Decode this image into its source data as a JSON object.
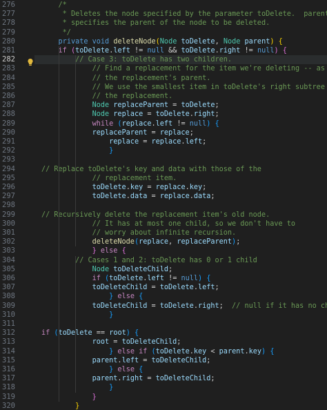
{
  "editor": {
    "language": "java",
    "active_line": 282,
    "gutter_icon": "lightbulb-icon",
    "colors": {
      "background": "#1f1f1f",
      "comment": "#6a9955",
      "keyword": "#569cd6",
      "control_keyword": "#c586c0",
      "type": "#4ec9b0",
      "function": "#dcdcaa",
      "variable": "#9cdcfe",
      "bracket_level_1": "#ffd700",
      "bracket_level_2": "#da70d6",
      "bracket_level_3": "#179fff"
    },
    "lines": [
      {
        "n": "276",
        "tokens": [
          [
            "cm",
            "/*"
          ]
        ]
      },
      {
        "n": "277",
        "tokens": [
          [
            "cm",
            "* Deletes the node specified by the parameter toDelete.  parent"
          ]
        ]
      },
      {
        "n": "278",
        "tokens": [
          [
            "cm",
            "* specifies the parent of the node to be deleted."
          ]
        ]
      },
      {
        "n": "279",
        "tokens": [
          [
            "cm",
            "*/"
          ]
        ]
      },
      {
        "n": "280",
        "tokens": [
          [
            "kw",
            "private"
          ],
          [
            "pl",
            " "
          ],
          [
            "kw",
            "void"
          ],
          [
            "pl",
            " "
          ],
          [
            "fn",
            "deleteNode"
          ],
          [
            "b1",
            "("
          ],
          [
            "ty",
            "Node"
          ],
          [
            "pl",
            " "
          ],
          [
            "var",
            "toDelete"
          ],
          [
            "pl",
            ", "
          ],
          [
            "ty",
            "Node"
          ],
          [
            "pl",
            " "
          ],
          [
            "var",
            "parent"
          ],
          [
            "b1",
            ")"
          ],
          [
            "pl",
            " "
          ],
          [
            "b1",
            "{"
          ]
        ]
      },
      {
        "n": "281",
        "tokens": [
          [
            "ctl",
            "if"
          ],
          [
            "pl",
            " "
          ],
          [
            "b2",
            "("
          ],
          [
            "var",
            "toDelete"
          ],
          [
            "pl",
            "."
          ],
          [
            "var",
            "left"
          ],
          [
            "pl",
            " != "
          ],
          [
            "kw",
            "null"
          ],
          [
            "pl",
            " && "
          ],
          [
            "var",
            "toDelete"
          ],
          [
            "pl",
            "."
          ],
          [
            "var",
            "right"
          ],
          [
            "pl",
            " != "
          ],
          [
            "kw",
            "null"
          ],
          [
            "b2",
            ")"
          ],
          [
            "pl",
            " "
          ],
          [
            "b2",
            "{"
          ]
        ]
      },
      {
        "n": "282",
        "tokens": [
          [
            "cm",
            "// Case 3: toDelete has two children."
          ]
        ]
      },
      {
        "n": "283",
        "tokens": [
          [
            "cm",
            "// Find a replacement for the item we're deleting -- as well as"
          ]
        ]
      },
      {
        "n": "284",
        "tokens": [
          [
            "cm",
            "// the replacement's parent."
          ]
        ]
      },
      {
        "n": "285",
        "tokens": [
          [
            "cm",
            "// We use the smallest item in toDelete's right subtree as"
          ]
        ]
      },
      {
        "n": "286",
        "tokens": [
          [
            "cm",
            "// the replacement."
          ]
        ]
      },
      {
        "n": "287",
        "tokens": [
          [
            "ty",
            "Node"
          ],
          [
            "pl",
            " "
          ],
          [
            "var",
            "replaceParent"
          ],
          [
            "pl",
            " = "
          ],
          [
            "var",
            "toDelete"
          ],
          [
            "pl",
            ";"
          ]
        ]
      },
      {
        "n": "288",
        "tokens": [
          [
            "ty",
            "Node"
          ],
          [
            "pl",
            " "
          ],
          [
            "var",
            "replace"
          ],
          [
            "pl",
            " = "
          ],
          [
            "var",
            "toDelete"
          ],
          [
            "pl",
            "."
          ],
          [
            "var",
            "right"
          ],
          [
            "pl",
            ";"
          ]
        ]
      },
      {
        "n": "289",
        "tokens": [
          [
            "ctl",
            "while"
          ],
          [
            "pl",
            " "
          ],
          [
            "b3",
            "("
          ],
          [
            "var",
            "replace"
          ],
          [
            "pl",
            "."
          ],
          [
            "var",
            "left"
          ],
          [
            "pl",
            " != "
          ],
          [
            "kw",
            "null"
          ],
          [
            "b3",
            ")"
          ],
          [
            "pl",
            " "
          ],
          [
            "b3",
            "{"
          ]
        ]
      },
      {
        "n": "290",
        "tokens": [
          [
            "var",
            "replaceParent"
          ],
          [
            "pl",
            " = "
          ],
          [
            "var",
            "replace"
          ],
          [
            "pl",
            ";"
          ]
        ]
      },
      {
        "n": "291",
        "tokens": [
          [
            "var",
            "replace"
          ],
          [
            "pl",
            " = "
          ],
          [
            "var",
            "replace"
          ],
          [
            "pl",
            "."
          ],
          [
            "var",
            "left"
          ],
          [
            "pl",
            ";"
          ]
        ]
      },
      {
        "n": "292",
        "tokens": [
          [
            "b3",
            "}"
          ]
        ]
      },
      {
        "n": "293",
        "tokens": []
      },
      {
        "n": "294",
        "tokens": [
          [
            "cm",
            "// Replace toDelete's key and data with those of the"
          ]
        ]
      },
      {
        "n": "295",
        "tokens": [
          [
            "cm",
            "// replacement item."
          ]
        ]
      },
      {
        "n": "296",
        "tokens": [
          [
            "var",
            "toDelete"
          ],
          [
            "pl",
            "."
          ],
          [
            "var",
            "key"
          ],
          [
            "pl",
            " = "
          ],
          [
            "var",
            "replace"
          ],
          [
            "pl",
            "."
          ],
          [
            "var",
            "key"
          ],
          [
            "pl",
            ";"
          ]
        ]
      },
      {
        "n": "297",
        "tokens": [
          [
            "var",
            "toDelete"
          ],
          [
            "pl",
            "."
          ],
          [
            "var",
            "data"
          ],
          [
            "pl",
            " = "
          ],
          [
            "var",
            "replace"
          ],
          [
            "pl",
            "."
          ],
          [
            "var",
            "data"
          ],
          [
            "pl",
            ";"
          ]
        ]
      },
      {
        "n": "298",
        "tokens": []
      },
      {
        "n": "299",
        "tokens": [
          [
            "cm",
            "// Recursively delete the replacement item's old node."
          ]
        ]
      },
      {
        "n": "300",
        "tokens": [
          [
            "cm",
            "// It has at most one child, so we don't have to"
          ]
        ]
      },
      {
        "n": "301",
        "tokens": [
          [
            "cm",
            "// worry about infinite recursion."
          ]
        ]
      },
      {
        "n": "302",
        "tokens": [
          [
            "fn",
            "deleteNode"
          ],
          [
            "b3",
            "("
          ],
          [
            "var",
            "replace"
          ],
          [
            "pl",
            ", "
          ],
          [
            "var",
            "replaceParent"
          ],
          [
            "b3",
            ")"
          ],
          [
            "pl",
            ";"
          ]
        ]
      },
      {
        "n": "303",
        "tokens": [
          [
            "b2",
            "}"
          ],
          [
            "pl",
            " "
          ],
          [
            "ctl",
            "else"
          ],
          [
            "pl",
            " "
          ],
          [
            "b2",
            "{"
          ]
        ]
      },
      {
        "n": "304",
        "tokens": [
          [
            "cm",
            "// Cases 1 and 2: toDelete has 0 or 1 child"
          ]
        ]
      },
      {
        "n": "305",
        "tokens": [
          [
            "ty",
            "Node"
          ],
          [
            "pl",
            " "
          ],
          [
            "var",
            "toDeleteChild"
          ],
          [
            "pl",
            ";"
          ]
        ]
      },
      {
        "n": "306",
        "tokens": [
          [
            "ctl",
            "if"
          ],
          [
            "pl",
            " "
          ],
          [
            "b3",
            "("
          ],
          [
            "var",
            "toDelete"
          ],
          [
            "pl",
            "."
          ],
          [
            "var",
            "left"
          ],
          [
            "pl",
            " != "
          ],
          [
            "kw",
            "null"
          ],
          [
            "b3",
            ")"
          ],
          [
            "pl",
            " "
          ],
          [
            "b3",
            "{"
          ]
        ]
      },
      {
        "n": "307",
        "tokens": [
          [
            "var",
            "toDeleteChild"
          ],
          [
            "pl",
            " = "
          ],
          [
            "var",
            "toDelete"
          ],
          [
            "pl",
            "."
          ],
          [
            "var",
            "left"
          ],
          [
            "pl",
            ";"
          ]
        ]
      },
      {
        "n": "308",
        "tokens": [
          [
            "b3",
            "}"
          ],
          [
            "pl",
            " "
          ],
          [
            "ctl",
            "else"
          ],
          [
            "pl",
            " "
          ],
          [
            "b3",
            "{"
          ]
        ]
      },
      {
        "n": "309",
        "tokens": [
          [
            "var",
            "toDeleteChild"
          ],
          [
            "pl",
            " = "
          ],
          [
            "var",
            "toDelete"
          ],
          [
            "pl",
            "."
          ],
          [
            "var",
            "right"
          ],
          [
            "pl",
            ";  "
          ],
          [
            "cm",
            "// null if it has no children"
          ]
        ]
      },
      {
        "n": "310",
        "tokens": [
          [
            "b3",
            "}"
          ]
        ]
      },
      {
        "n": "311",
        "tokens": []
      },
      {
        "n": "312",
        "tokens": [
          [
            "ctl",
            "if"
          ],
          [
            "pl",
            " "
          ],
          [
            "b3",
            "("
          ],
          [
            "var",
            "toDelete"
          ],
          [
            "pl",
            " == "
          ],
          [
            "var",
            "root"
          ],
          [
            "b3",
            ")"
          ],
          [
            "pl",
            " "
          ],
          [
            "b3",
            "{"
          ]
        ]
      },
      {
        "n": "313",
        "tokens": [
          [
            "var",
            "root"
          ],
          [
            "pl",
            " = "
          ],
          [
            "var",
            "toDeleteChild"
          ],
          [
            "pl",
            ";"
          ]
        ]
      },
      {
        "n": "314",
        "tokens": [
          [
            "b3",
            "}"
          ],
          [
            "pl",
            " "
          ],
          [
            "ctl",
            "else if"
          ],
          [
            "pl",
            " "
          ],
          [
            "b3",
            "("
          ],
          [
            "var",
            "toDelete"
          ],
          [
            "pl",
            "."
          ],
          [
            "var",
            "key"
          ],
          [
            "pl",
            " < "
          ],
          [
            "var",
            "parent"
          ],
          [
            "pl",
            "."
          ],
          [
            "var",
            "key"
          ],
          [
            "b3",
            ")"
          ],
          [
            "pl",
            " "
          ],
          [
            "b3",
            "{"
          ]
        ]
      },
      {
        "n": "315",
        "tokens": [
          [
            "var",
            "parent"
          ],
          [
            "pl",
            "."
          ],
          [
            "var",
            "left"
          ],
          [
            "pl",
            " = "
          ],
          [
            "var",
            "toDeleteChild"
          ],
          [
            "pl",
            ";"
          ]
        ]
      },
      {
        "n": "316",
        "tokens": [
          [
            "b3",
            "}"
          ],
          [
            "pl",
            " "
          ],
          [
            "ctl",
            "else"
          ],
          [
            "pl",
            " "
          ],
          [
            "b3",
            "{"
          ]
        ]
      },
      {
        "n": "317",
        "tokens": [
          [
            "var",
            "parent"
          ],
          [
            "pl",
            "."
          ],
          [
            "var",
            "right"
          ],
          [
            "pl",
            " = "
          ],
          [
            "var",
            "toDeleteChild"
          ],
          [
            "pl",
            ";"
          ]
        ]
      },
      {
        "n": "318",
        "tokens": [
          [
            "b3",
            "}"
          ]
        ]
      },
      {
        "n": "319",
        "tokens": [
          [
            "b2",
            "}"
          ]
        ]
      },
      {
        "n": "320",
        "tokens": [
          [
            "b1",
            "}"
          ]
        ]
      }
    ]
  }
}
